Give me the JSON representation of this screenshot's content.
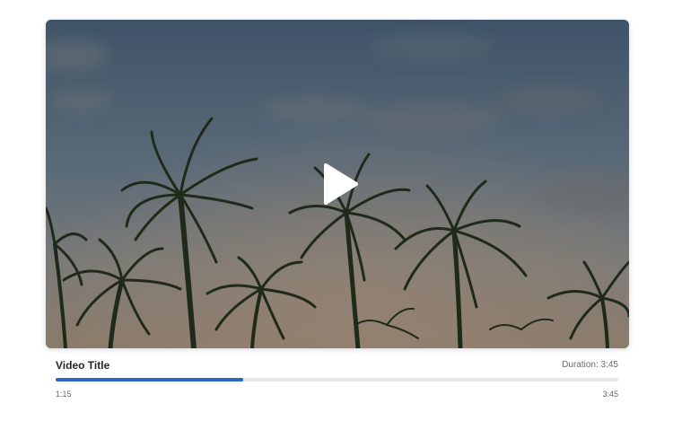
{
  "video": {
    "title": "Video Title",
    "duration_label": "Duration: 3:45",
    "current_time": "1:15",
    "total_time": "3:45",
    "progress_fraction": 0.3333,
    "play_icon": "play-icon",
    "accent_color": "#2f66c9"
  }
}
